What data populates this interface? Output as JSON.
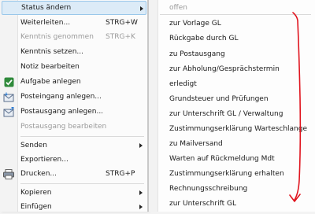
{
  "menu": {
    "items": [
      {
        "label": "Status ändern",
        "shortcut": "",
        "submenu": true,
        "disabled": false,
        "highlighted": true,
        "icon": ""
      },
      {
        "label": "Weiterleiten...",
        "shortcut": "STRG+W",
        "submenu": false,
        "disabled": false,
        "highlighted": false,
        "icon": ""
      },
      {
        "label": "Kenntnis genommen",
        "shortcut": "STRG+K",
        "submenu": false,
        "disabled": true,
        "highlighted": false,
        "icon": ""
      },
      {
        "label": "Kenntnis setzen...",
        "shortcut": "",
        "submenu": false,
        "disabled": false,
        "highlighted": false,
        "icon": ""
      },
      {
        "label": "Notiz bearbeiten",
        "shortcut": "",
        "submenu": false,
        "disabled": false,
        "highlighted": false,
        "icon": ""
      },
      {
        "label": "Aufgabe anlegen",
        "shortcut": "",
        "submenu": false,
        "disabled": false,
        "highlighted": false,
        "icon": "check-icon"
      },
      {
        "label": "Posteingang anlegen...",
        "shortcut": "",
        "submenu": false,
        "disabled": false,
        "highlighted": false,
        "icon": "inbox-icon"
      },
      {
        "label": "Postausgang anlegen...",
        "shortcut": "",
        "submenu": false,
        "disabled": false,
        "highlighted": false,
        "icon": "outbox-icon"
      },
      {
        "label": "Postausgang bearbeiten",
        "shortcut": "",
        "submenu": false,
        "disabled": true,
        "highlighted": false,
        "icon": ""
      },
      {
        "label": "Senden",
        "shortcut": "",
        "submenu": true,
        "disabled": false,
        "highlighted": false,
        "icon": ""
      },
      {
        "label": "Exportieren...",
        "shortcut": "",
        "submenu": false,
        "disabled": false,
        "highlighted": false,
        "icon": ""
      },
      {
        "label": "Drucken...",
        "shortcut": "STRG+P",
        "submenu": false,
        "disabled": false,
        "highlighted": false,
        "icon": "printer-icon"
      },
      {
        "label": "Kopieren",
        "shortcut": "",
        "submenu": true,
        "disabled": false,
        "highlighted": false,
        "icon": ""
      },
      {
        "label": "Einfügen",
        "shortcut": "",
        "submenu": true,
        "disabled": false,
        "highlighted": false,
        "icon": ""
      }
    ]
  },
  "submenu": {
    "items": [
      {
        "label": "offen",
        "disabled": true
      },
      {
        "label": "zur Vorlage GL",
        "disabled": false
      },
      {
        "label": "Rückgabe durch GL",
        "disabled": false
      },
      {
        "label": "zu Postausgang",
        "disabled": false
      },
      {
        "label": "zur Abholung/Gesprächstermin",
        "disabled": false
      },
      {
        "label": "erledigt",
        "disabled": false
      },
      {
        "label": "Grundsteuer und Prüfungen",
        "disabled": false
      },
      {
        "label": "zur Unterschrift GL / Verwaltung",
        "disabled": false
      },
      {
        "label": "Zustimmungserklärung Warteschlange",
        "disabled": false
      },
      {
        "label": "zu Mailversand",
        "disabled": false
      },
      {
        "label": "Warten auf Rückmeldung Mdt",
        "disabled": false
      },
      {
        "label": "Zustimmungserklärung erhalten",
        "disabled": false
      },
      {
        "label": "Rechnungsschreibung",
        "disabled": false
      },
      {
        "label": "zur Unterschrift GL",
        "disabled": false
      }
    ]
  },
  "colors": {
    "annotation": "#e0141e",
    "highlight": "#dcebf7"
  }
}
